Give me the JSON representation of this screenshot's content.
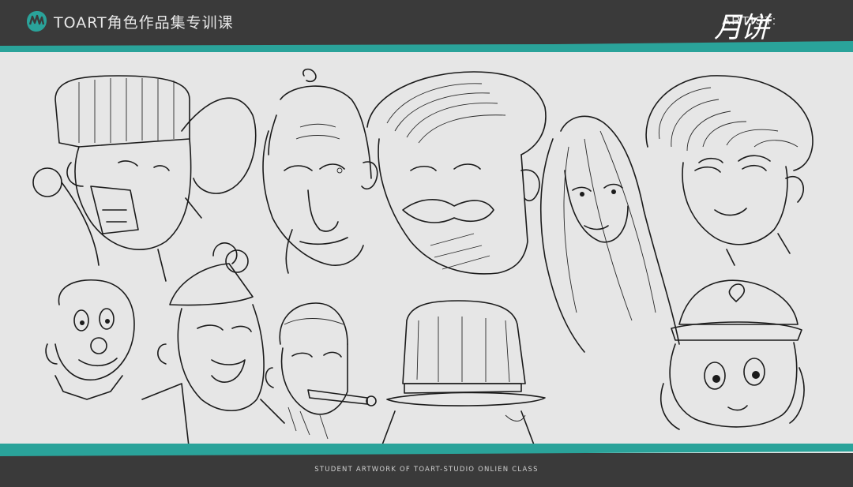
{
  "header": {
    "brand": "TOART角色作品集专训课",
    "artist_label": "ARTIST:",
    "artist_name": "月饼",
    "logo_icon": "toart-logo-icon"
  },
  "footer": {
    "caption": "STUDENT ARTWORK OF TOART-STUDIO ONLIEN CLASS"
  },
  "colors": {
    "accent": "#2aa39a",
    "bar": "#3a3a3a",
    "canvas": "#e6e6e6"
  }
}
